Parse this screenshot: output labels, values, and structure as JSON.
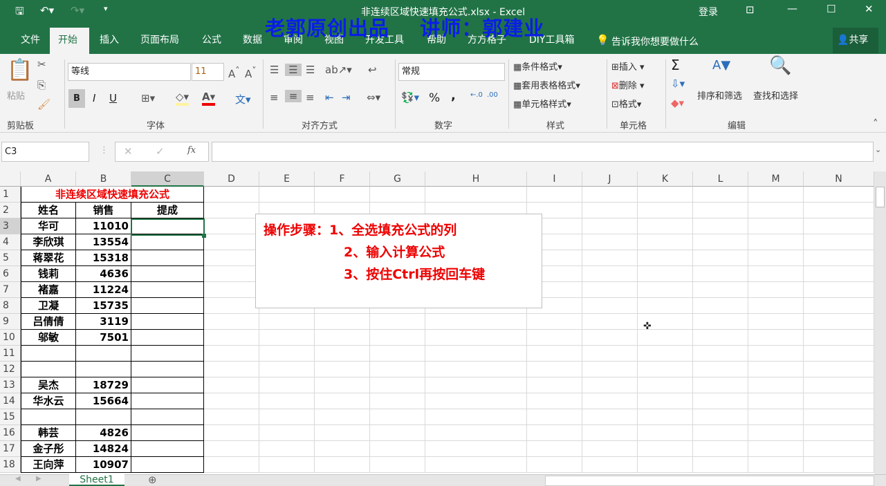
{
  "window": {
    "title": "非连续区域快速填充公式.xlsx  -  Excel",
    "login": "登录",
    "watermark": "老郭原创出品    讲师：郭建业",
    "share": "共享"
  },
  "tabs": [
    "文件",
    "开始",
    "插入",
    "页面布局",
    "公式",
    "数据",
    "审阅",
    "视图",
    "开发工具",
    "帮助",
    "方方格子",
    "DIY工具箱"
  ],
  "tell_me": "告诉我你想要做什么",
  "ribbon": {
    "clipboard": {
      "paste": "粘贴",
      "label": "剪贴板"
    },
    "font": {
      "name": "等线",
      "size": "11",
      "label": "字体",
      "bold": "B",
      "italic": "I",
      "underline": "U"
    },
    "alignment": {
      "label": "对齐方式"
    },
    "number": {
      "format": "常规",
      "label": "数字",
      "percent": "%",
      "comma": ","
    },
    "styles": {
      "conditional": "条件格式",
      "table": "套用表格格式",
      "cell": "单元格样式",
      "label": "样式"
    },
    "cells": {
      "insert": "插入",
      "delete": "删除",
      "format": "格式",
      "label": "单元格"
    },
    "editing": {
      "sort": "排序和筛选",
      "find": "查找和选择",
      "label": "编辑",
      "sum": "Σ"
    }
  },
  "formula_bar": {
    "name_box": "C3",
    "fx": "fx",
    "value": ""
  },
  "columns": [
    "A",
    "B",
    "C",
    "D",
    "E",
    "F",
    "G",
    "H",
    "I",
    "J",
    "K",
    "L",
    "M",
    "N"
  ],
  "sheet": {
    "title": "非连续区域快速填充公式",
    "headers": [
      "姓名",
      "销售",
      "提成"
    ],
    "rows": [
      [
        "华可",
        "11010",
        ""
      ],
      [
        "李欣琪",
        "13554",
        ""
      ],
      [
        "蒋翠花",
        "15318",
        ""
      ],
      [
        "钱莉",
        "4636",
        ""
      ],
      [
        "褚嘉",
        "11224",
        ""
      ],
      [
        "卫凝",
        "15735",
        ""
      ],
      [
        "吕倩倩",
        "3119",
        ""
      ],
      [
        "邬敏",
        "7501",
        ""
      ],
      [
        "",
        "",
        ""
      ],
      [
        "",
        "",
        ""
      ],
      [
        "吴杰",
        "18729",
        ""
      ],
      [
        "华水云",
        "15664",
        ""
      ],
      [
        "",
        "",
        ""
      ],
      [
        "韩芸",
        "4826",
        ""
      ],
      [
        "金子彤",
        "14824",
        ""
      ],
      [
        "王向萍",
        "10907",
        ""
      ]
    ]
  },
  "textbox": {
    "lines": [
      "操作步骤：1、全选填充公式的列",
      "2、输入计算公式",
      "3、按住Ctrl再按回车键"
    ]
  },
  "sheet_tabs": {
    "active": "Sheet1"
  },
  "colors": {
    "excel_green": "#217346",
    "watermark": "#0a1ee6",
    "red_text": "#ee0000",
    "selection": "#217346"
  }
}
